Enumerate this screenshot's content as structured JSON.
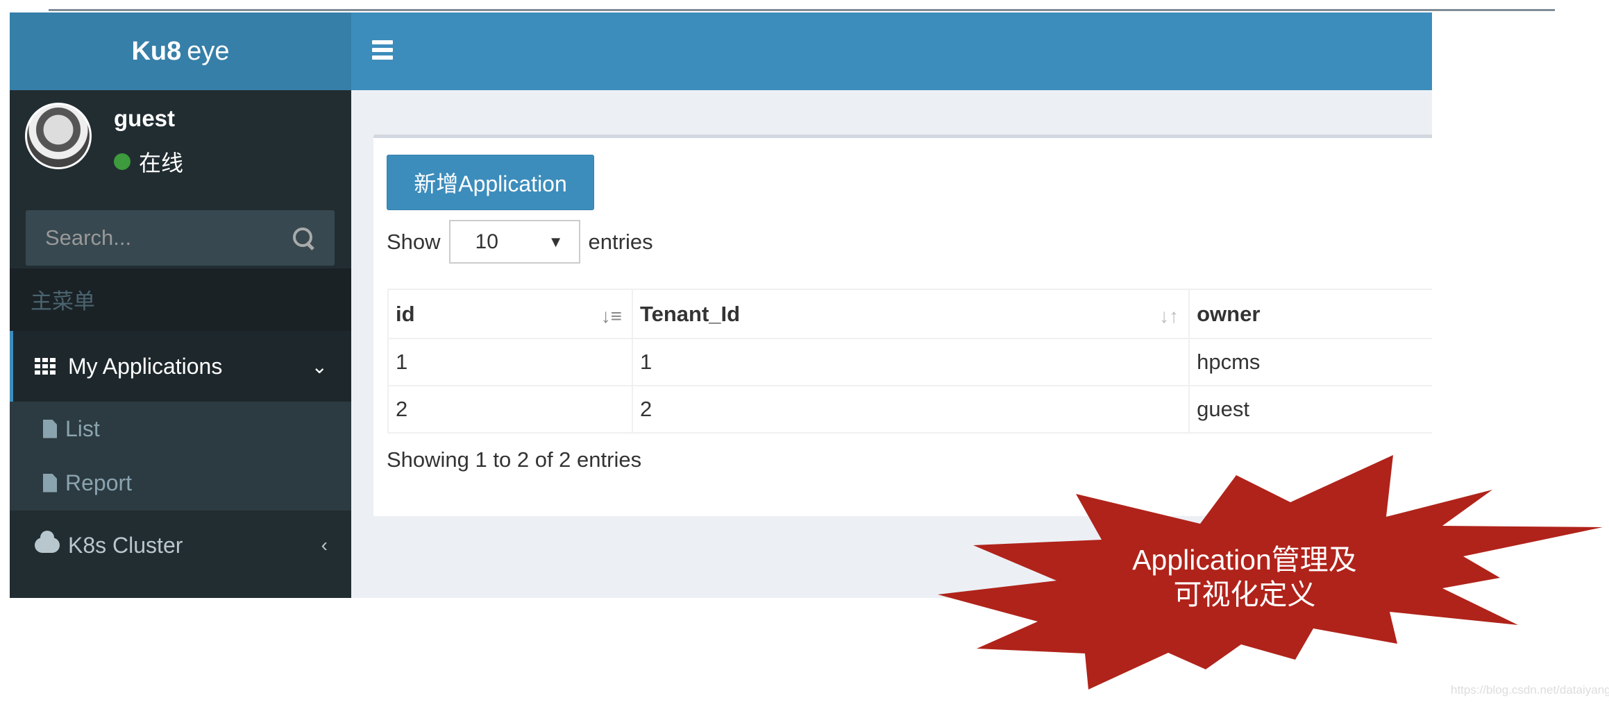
{
  "brand": {
    "bold": "Ku8",
    "rest": "eye"
  },
  "user": {
    "name": "guest",
    "status": "在线",
    "status_color": "#3d9a3d"
  },
  "search": {
    "placeholder": "Search..."
  },
  "sidebar": {
    "header": "主菜单",
    "items": [
      {
        "label": "My Applications",
        "icon": "grid-icon",
        "expanded": true,
        "children": [
          {
            "label": "List",
            "icon": "file-icon"
          },
          {
            "label": "Report",
            "icon": "file-icon"
          }
        ]
      },
      {
        "label": "K8s Cluster",
        "icon": "cloud-icon",
        "expanded": false
      }
    ]
  },
  "main": {
    "add_button": "新增Application",
    "show_label": "Show",
    "entries_label": "entries",
    "page_size": "10",
    "table": {
      "columns": [
        "id",
        "Tenant_Id",
        "owner"
      ],
      "rows": [
        [
          "1",
          "1",
          "hpcms"
        ],
        [
          "2",
          "2",
          "guest"
        ]
      ]
    },
    "info": "Showing 1 to 2 of 2 entries"
  },
  "callout": {
    "line1": "Application管理及",
    "line2": "可视化定义",
    "color": "#b0231a"
  },
  "watermark": "https://blog.csdn.net/dataiyangu",
  "colors": {
    "header": "#3c8dbc",
    "logo": "#367fa9",
    "sidebar": "#222d32"
  }
}
